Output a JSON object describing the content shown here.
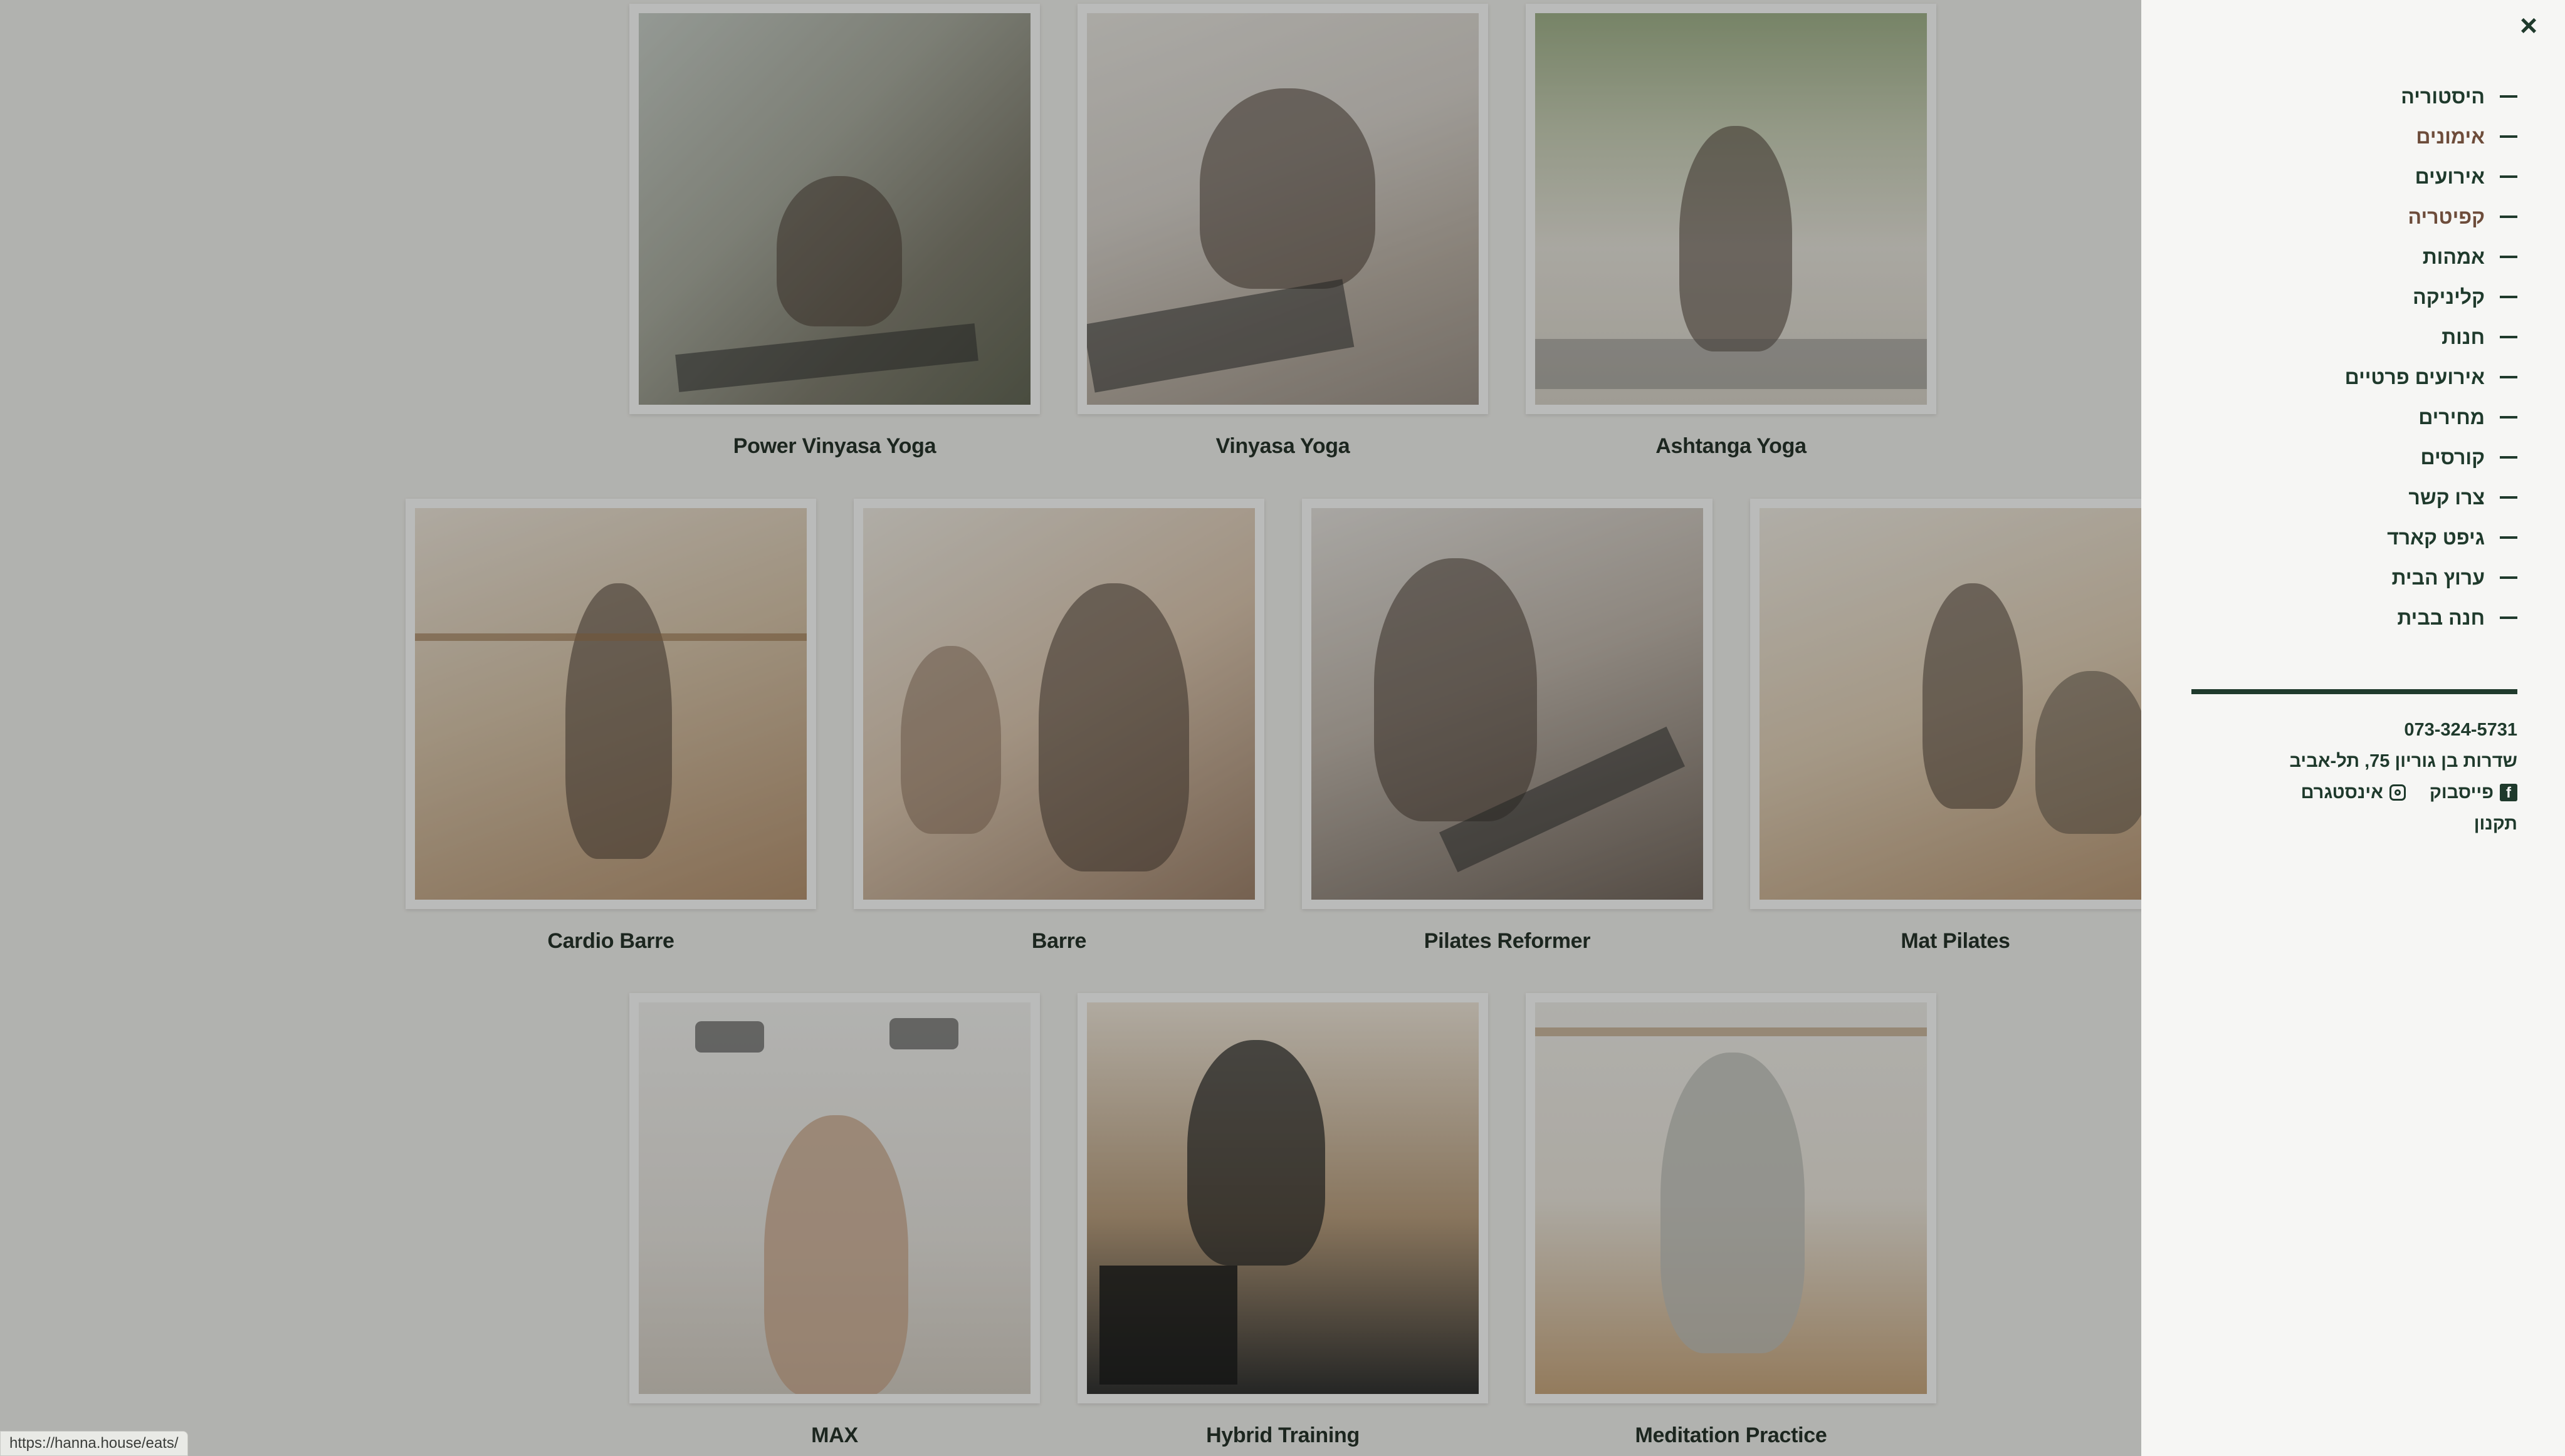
{
  "classes": [
    {
      "name": "Power Vinyasa Yoga"
    },
    {
      "name": "Vinyasa Yoga"
    },
    {
      "name": "Ashtanga Yoga"
    },
    {
      "name": "Cardio Barre"
    },
    {
      "name": "Barre"
    },
    {
      "name": "Pilates Reformer"
    },
    {
      "name": "Mat Pilates"
    },
    {
      "name": "MAX"
    },
    {
      "name": "Hybrid Training"
    },
    {
      "name": "Meditation Practice"
    }
  ],
  "menu": {
    "close_icon": "×",
    "items": [
      {
        "label": "היסטוריה"
      },
      {
        "label": "אימונים"
      },
      {
        "label": "אירועים"
      },
      {
        "label": "קפיטריה"
      },
      {
        "label": "אמהות"
      },
      {
        "label": "קליניקה"
      },
      {
        "label": "חנות"
      },
      {
        "label": "אירועים פרטיים"
      },
      {
        "label": "מחירים"
      },
      {
        "label": "קורסים"
      },
      {
        "label": "צרו קשר"
      },
      {
        "label": "גיפט קארד"
      },
      {
        "label": "ערוץ הבית"
      },
      {
        "label": "חנה בבית"
      }
    ]
  },
  "contact": {
    "phone": "073-324-5731",
    "address": "שדרות בן גוריון 75, תל-אביב",
    "facebook_label": "פייסבוק",
    "instagram_label": "אינסטגרם",
    "terms_label": "תקנון",
    "facebook_glyph": "f"
  },
  "status_bar": {
    "url": "https://hanna.house/eats/"
  },
  "colors": {
    "accent": "#1f3a2c",
    "brown": "#6d4c3a",
    "panel_bg": "#f6f6f4"
  }
}
